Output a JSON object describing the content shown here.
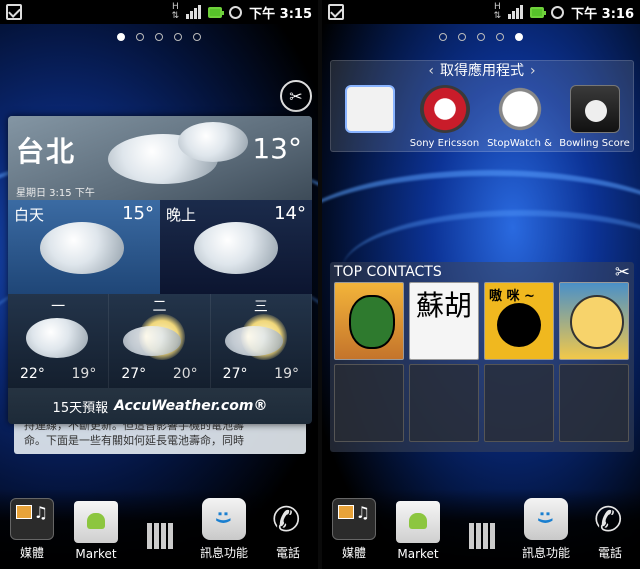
{
  "left": {
    "status": {
      "h_indicator": "H",
      "time": "下午 3:15"
    },
    "page_dots": [
      false,
      true,
      false,
      false,
      false
    ],
    "weather": {
      "city": "台北",
      "current_temp": "13°",
      "datetime": "星期日 3:15 下午",
      "day_label": "白天",
      "day_temp": "15°",
      "night_label": "晚上",
      "night_temp": "14°",
      "forecast": [
        {
          "day": "一",
          "hi": "22°",
          "lo": "19°"
        },
        {
          "day": "二",
          "hi": "27°",
          "lo": "20°"
        },
        {
          "day": "三",
          "hi": "27°",
          "lo": "19°"
        }
      ],
      "footer_text": "15天預報",
      "brand": "AccuWeather.com®"
    },
    "note_text": "持連線，不斷更新。但這曾影響手機的電池壽命。下面是一些有關如何延長電池壽命，同時",
    "dock": {
      "media": "媒體",
      "market": "Market",
      "messaging": "訊息功能",
      "phone": "電話"
    }
  },
  "right": {
    "status": {
      "h_indicator": "H",
      "time": "下午 3:16"
    },
    "page_dots": [
      false,
      false,
      false,
      false,
      true
    ],
    "apps_widget": {
      "title": "取得應用程式",
      "apps": [
        {
          "label": ""
        },
        {
          "label": "Sony Ericsson"
        },
        {
          "label": "StopWatch &"
        },
        {
          "label": "Bowling Score"
        }
      ]
    },
    "contacts": {
      "title": "TOP CONTACTS",
      "cell_b_text": "蘇胡",
      "cell_c_text": "嗷 咪 ~"
    },
    "dock": {
      "media": "媒體",
      "market": "Market",
      "messaging": "訊息功能",
      "phone": "電話"
    }
  }
}
